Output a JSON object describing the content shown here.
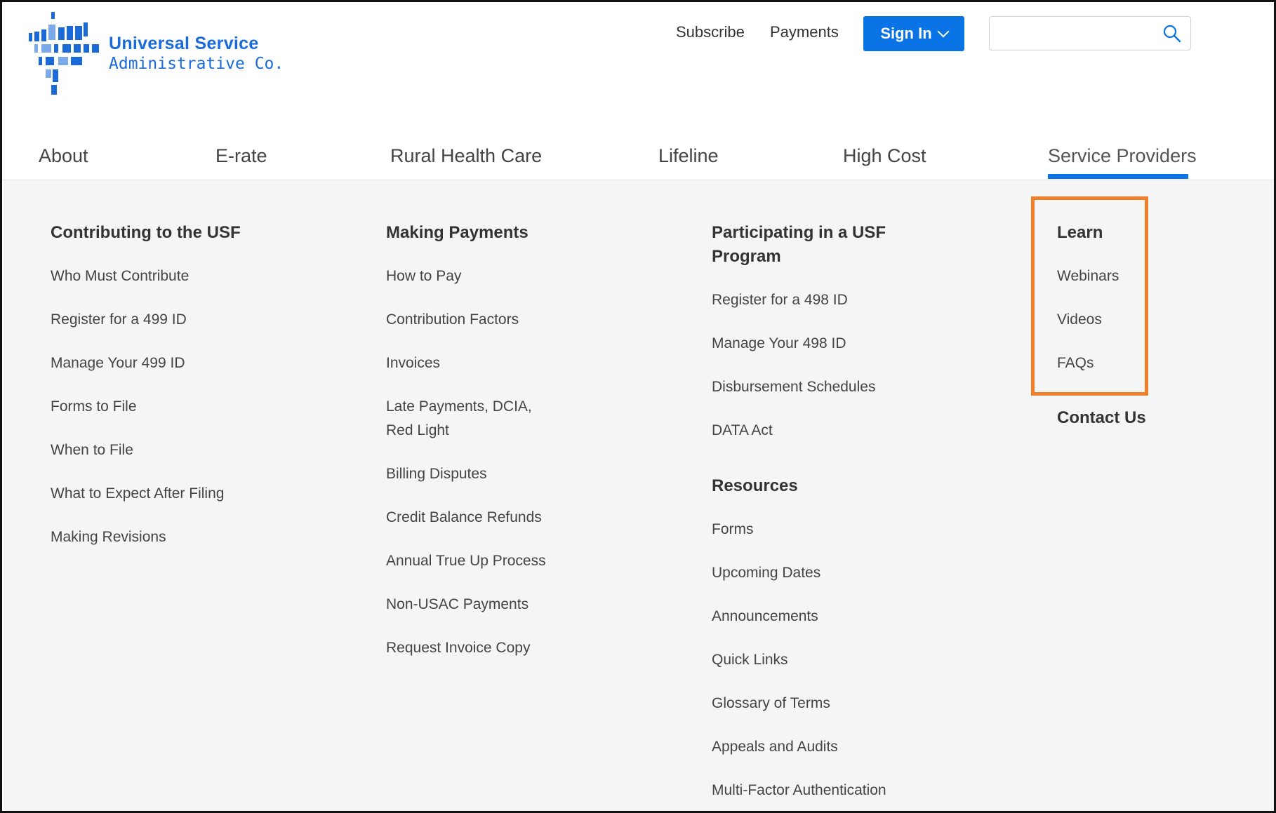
{
  "logo": {
    "line1": "Universal Service",
    "line2": "Administrative Co."
  },
  "utility_nav": {
    "subscribe": "Subscribe",
    "payments": "Payments",
    "sign_in": "Sign In"
  },
  "search": {
    "placeholder": ""
  },
  "main_nav": {
    "items": [
      "About",
      "E-rate",
      "Rural Health Care",
      "Lifeline",
      "High Cost",
      "Service Providers"
    ],
    "active": "Service Providers"
  },
  "mega_menu": {
    "col1": {
      "heading": "Contributing to the USF",
      "links": [
        "Who Must Contribute",
        "Register for a 499 ID",
        "Manage Your 499 ID",
        "Forms to File",
        "When to File",
        "What to Expect After Filing",
        "Making Revisions"
      ]
    },
    "col2": {
      "heading": "Making Payments",
      "links": [
        "How to Pay",
        "Contribution Factors",
        "Invoices",
        "Late Payments, DCIA, Red Light",
        "Billing Disputes",
        "Credit Balance Refunds",
        "Annual True Up Process",
        "Non-USAC Payments",
        "Request Invoice Copy"
      ]
    },
    "col3": {
      "heading": "Participating in a USF Program",
      "links": [
        "Register for a 498 ID",
        "Manage Your 498 ID",
        "Disbursement Schedules",
        "DATA Act"
      ],
      "heading2": "Resources",
      "links2": [
        "Forms",
        "Upcoming Dates",
        "Announcements",
        "Quick Links",
        "Glossary of Terms",
        "Appeals and Audits",
        "Multi-Factor Authentication"
      ]
    },
    "col4": {
      "heading": "Learn",
      "links": [
        "Webinars",
        "Videos",
        "FAQs"
      ],
      "heading2": "Contact Us"
    }
  },
  "colors": {
    "brand_blue": "#0a73e6",
    "highlight_orange": "#ef7f2b",
    "menu_bg": "#f5f5f5"
  }
}
